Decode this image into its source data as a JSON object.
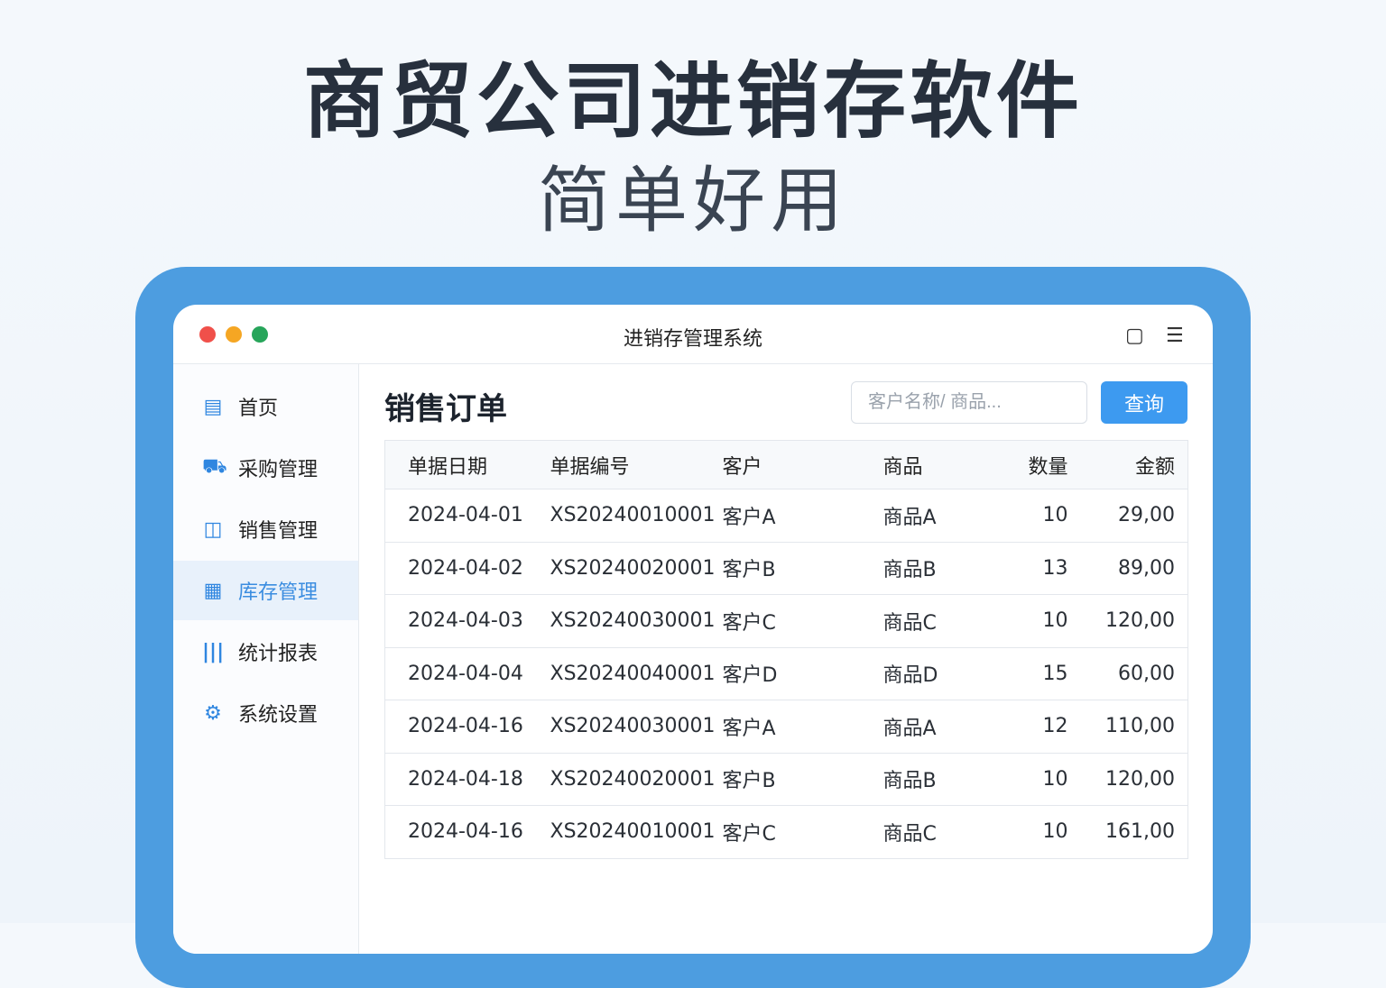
{
  "hero": {
    "title": "商贸公司进销存软件",
    "subtitle": "简单好用"
  },
  "window": {
    "title": "进销存管理系统",
    "colors": {
      "close": "#f0504a",
      "minimize": "#f5a623",
      "maximize": "#27a55a"
    }
  },
  "sidebar": {
    "items": [
      {
        "label": "首页",
        "icon": "document-icon"
      },
      {
        "label": "采购管理",
        "icon": "cart-icon"
      },
      {
        "label": "销售管理",
        "icon": "sales-icon"
      },
      {
        "label": "库存管理",
        "icon": "grid-icon",
        "active": true
      },
      {
        "label": "统计报表",
        "icon": "bar-chart-icon"
      },
      {
        "label": "系统设置",
        "icon": "gear-icon"
      }
    ]
  },
  "main": {
    "title": "销售订单",
    "search_placeholder": "客户名称/ 商品...",
    "query_label": "查询",
    "columns": [
      "单据日期",
      "单据编号",
      "客户",
      "商品",
      "数量",
      "金额"
    ],
    "rows": [
      [
        "2024-04-01",
        "XS20240010001",
        "客户A",
        "商品A",
        "10",
        "29,00"
      ],
      [
        "2024-04-02",
        "XS20240020001",
        "客户B",
        "商品B",
        "13",
        "89,00"
      ],
      [
        "2024-04-03",
        "XS20240030001",
        "客户C",
        "商品C",
        "10",
        "120,00"
      ],
      [
        "2024-04-04",
        "XS20240040001",
        "客户D",
        "商品D",
        "15",
        "60,00"
      ],
      [
        "2024-04-16",
        "XS20240030001",
        "客户A",
        "商品A",
        "12",
        "110,00"
      ],
      [
        "2024-04-18",
        "XS20240020001",
        "客户B",
        "商品B",
        "10",
        "120,00"
      ],
      [
        "2024-04-16",
        "XS20240010001",
        "客户C",
        "商品C",
        "10",
        "161,00"
      ]
    ]
  }
}
